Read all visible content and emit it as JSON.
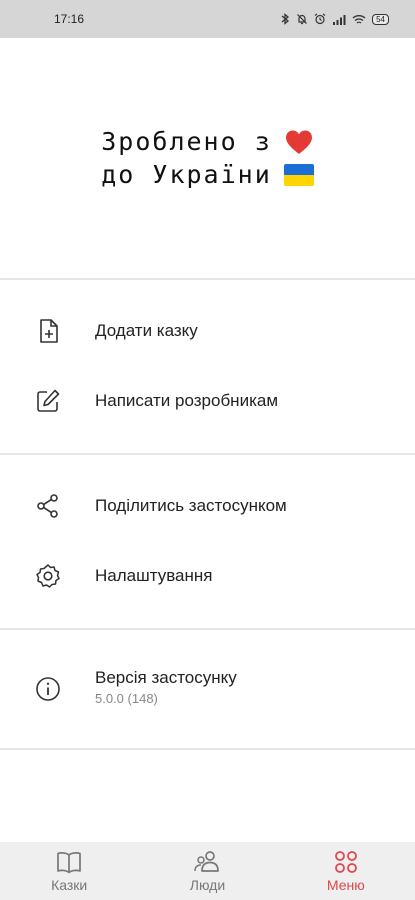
{
  "status_bar": {
    "time": "17:16",
    "battery": "54"
  },
  "hero": {
    "line1": "Зроблено з",
    "line2": "до України"
  },
  "menu": {
    "add_tale": "Додати казку",
    "write_devs": "Написати розробникам",
    "share_app": "Поділитись застосунком",
    "settings": "Налаштування",
    "version_title": "Версія застосунку",
    "version_value": "5.0.0 (148)"
  },
  "bottom_nav": {
    "tales": "Казки",
    "people": "Люди",
    "menu": "Меню"
  },
  "colors": {
    "accent": "#e0474c",
    "status_bar_bg": "#d6d6d6",
    "nav_bg": "#efefef"
  }
}
